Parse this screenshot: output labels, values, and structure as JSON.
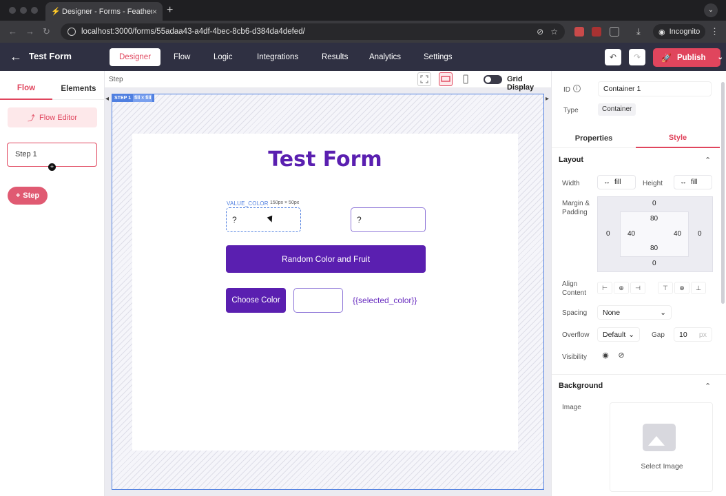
{
  "browser": {
    "tab_title": "Designer - Forms - Feathery",
    "url": "localhost:3000/forms/55adaa43-a4df-4bec-8cb6-d384da4defed/",
    "incognito_label": "Incognito"
  },
  "header": {
    "form_name": "Test Form",
    "nav_tabs": [
      "Designer",
      "Flow",
      "Logic",
      "Integrations",
      "Results",
      "Analytics",
      "Settings"
    ],
    "active_tab": "Designer",
    "publish_label": "Publish"
  },
  "left_panel": {
    "tabs": [
      "Flow",
      "Elements"
    ],
    "flow_editor_label": "Flow Editor",
    "step_name": "Step 1",
    "add_step_label": "Step"
  },
  "canvas": {
    "step_label": "Step",
    "grid_display_label": "Grid Display",
    "step_chip": "STEP 1",
    "step_chip_fill": "fill × fill",
    "form_title": "Test Form",
    "value_color_label": "VALUE_COLOR",
    "value_color_size": "150px × 50px",
    "field1_value": "?",
    "field2_value": "?",
    "random_button_label": "Random Color and Fruit",
    "choose_color_label": "Choose Color",
    "selected_color_template": "{{selected_color}}"
  },
  "right_panel": {
    "id_label": "ID",
    "id_value": "Container 1",
    "type_label": "Type",
    "type_value": "Container",
    "tabs": [
      "Properties",
      "Style"
    ],
    "active_tab": "Style",
    "layout_heading": "Layout",
    "width_label": "Width",
    "width_value": "fill",
    "height_label": "Height",
    "height_value": "fill",
    "margin_padding_label_1": "Margin &",
    "margin_padding_label_2": "Padding",
    "margin": {
      "top": "0",
      "left": "0",
      "right": "0",
      "bottom": "0"
    },
    "padding": {
      "top": "80",
      "left": "40",
      "right": "40",
      "bottom": "80"
    },
    "align_label_1": "Align",
    "align_label_2": "Content",
    "spacing_label": "Spacing",
    "spacing_value": "None",
    "overflow_label": "Overflow",
    "overflow_value": "Default",
    "gap_label": "Gap",
    "gap_value": "10",
    "gap_unit": "px",
    "visibility_label": "Visibility",
    "background_heading": "Background",
    "image_label": "Image",
    "select_image_label": "Select Image"
  },
  "colors": {
    "accent": "#e0455d",
    "header_bg": "#2f3042",
    "form_purple": "#5a1fb0",
    "selection_blue": "#4f7fe0"
  }
}
